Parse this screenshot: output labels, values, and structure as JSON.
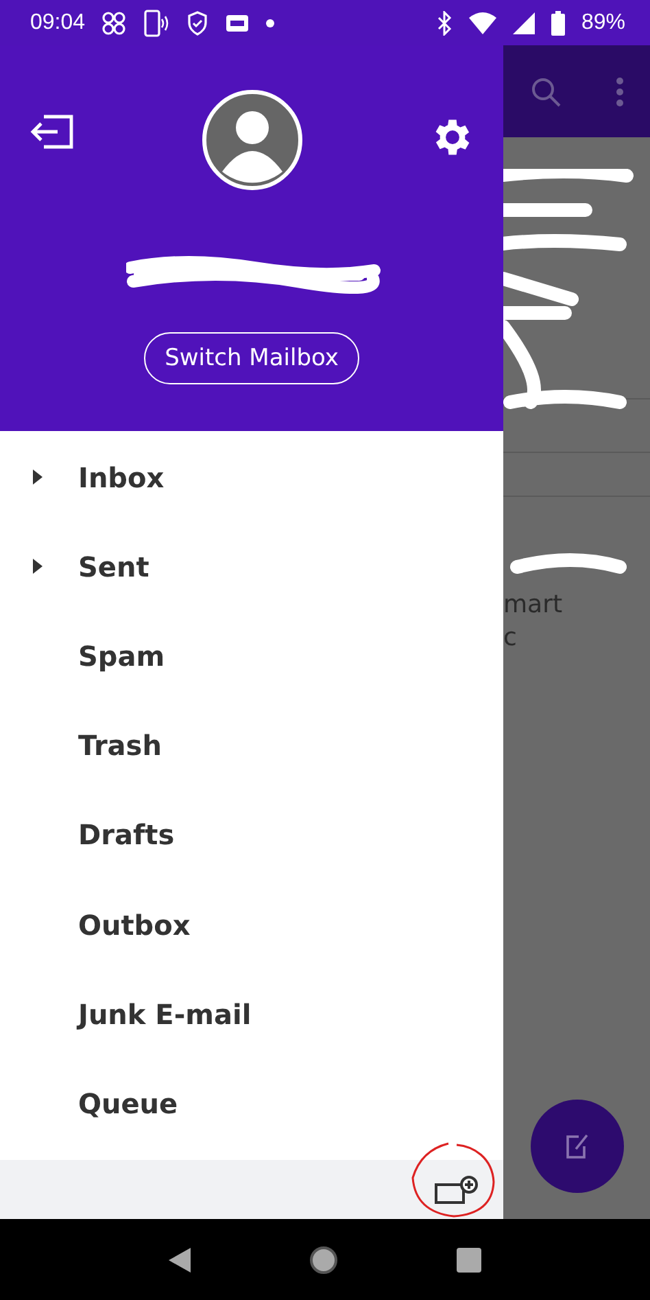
{
  "status_bar": {
    "time": "09:04",
    "battery": "89%"
  },
  "drawer": {
    "switch_button": "Switch Mailbox",
    "folders": [
      {
        "label": "Inbox",
        "expandable": true
      },
      {
        "label": "Sent",
        "expandable": true
      },
      {
        "label": "Spam",
        "expandable": false
      },
      {
        "label": "Trash",
        "expandable": false
      },
      {
        "label": "Drafts",
        "expandable": false
      },
      {
        "label": "Outbox",
        "expandable": false
      },
      {
        "label": "Junk E-mail",
        "expandable": false
      },
      {
        "label": "Queue",
        "expandable": false
      }
    ]
  },
  "background": {
    "snippets": [
      "mart",
      "c"
    ]
  }
}
